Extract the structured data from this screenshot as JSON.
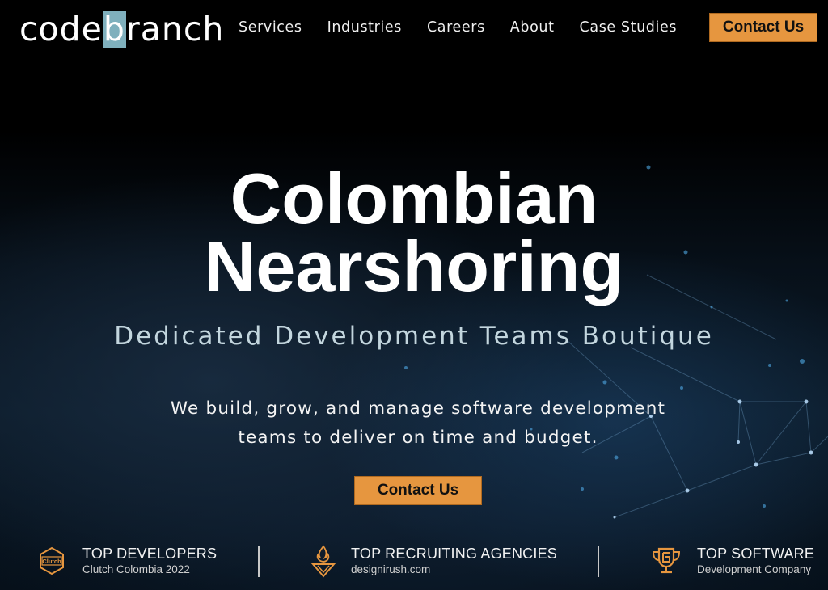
{
  "header": {
    "logo": {
      "prefix": "code",
      "highlight": "b",
      "suffix": "ranch"
    },
    "nav": [
      {
        "label": "Services"
      },
      {
        "label": "Industries"
      },
      {
        "label": "Careers"
      },
      {
        "label": "About"
      },
      {
        "label": "Case Studies"
      }
    ],
    "cta_label": "Contact Us"
  },
  "hero": {
    "title_line1": "Colombian",
    "title_line2": "Nearshoring",
    "subtitle": "Dedicated Development Teams Boutique",
    "description_line1": "We build, grow, and manage software development",
    "description_line2": "teams to deliver on time and budget.",
    "cta_label": "Contact Us"
  },
  "awards": [
    {
      "icon": "clutch-badge-icon",
      "title": "TOP DEVELOPERS",
      "subtitle": "Clutch Colombia 2022"
    },
    {
      "icon": "designrush-flame-icon",
      "title": "TOP RECRUITING AGENCIES",
      "subtitle": "designirush.com"
    },
    {
      "icon": "trophy-icon",
      "title": "TOP SOFTWARE",
      "subtitle": "Development Company"
    }
  ],
  "colors": {
    "accent": "#e6963f",
    "logo_highlight": "#7fb0bd",
    "subtitle": "#c3d6de",
    "background": "#000000"
  }
}
